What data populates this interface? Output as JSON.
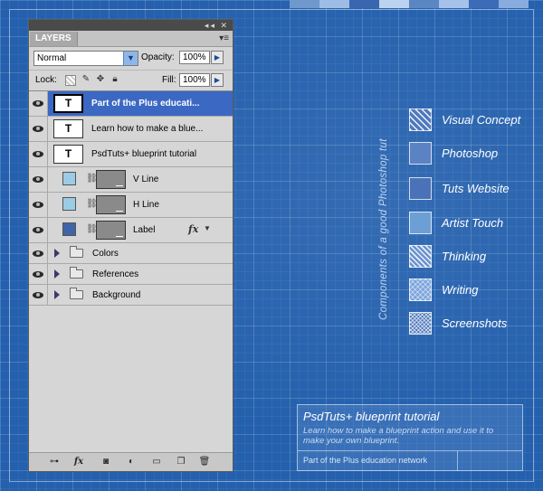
{
  "canvas": {
    "swatch_strip_colors": [
      "#6f98cc",
      "#9dbde6",
      "#3a66b0",
      "#bcd3f0",
      "#5b86c4",
      "#a4c2ea",
      "#3c6cb8",
      "#88acdf"
    ]
  },
  "vertical_caption": "Components of a good Photoshop tut",
  "legend": {
    "items": [
      {
        "label": "Visual Concept",
        "pattern": "stripes-diagonal"
      },
      {
        "label": "Photoshop",
        "pattern": "solid-medium"
      },
      {
        "label": "Tuts Website",
        "pattern": "solid-dark"
      },
      {
        "label": "Artist Touch",
        "pattern": "solid-light"
      },
      {
        "label": "Thinking",
        "pattern": "stripes-diagonal-light"
      },
      {
        "label": "Writing",
        "pattern": "crosshatch-light"
      },
      {
        "label": "Screenshots",
        "pattern": "crosshatch-dense"
      }
    ]
  },
  "info_box": {
    "title": "PsdTuts+ blueprint tutorial",
    "description": "Learn how to make a blueprint action and use it to make your own blueprint.",
    "footer": "Part of the Plus education network"
  },
  "layers_panel": {
    "titlebar_icons": "◂◂ ✕",
    "tab": "LAYERS",
    "menu_icon": "▾≡",
    "blend_mode": "Normal",
    "opacity_label": "Opacity:",
    "opacity": "100%",
    "lock_label": "Lock:",
    "fill_label": "Fill:",
    "fill": "100%",
    "layers": [
      {
        "kind": "type",
        "name": "Part of the Plus educati...",
        "thumb": "T",
        "selected": true
      },
      {
        "kind": "type",
        "name": "Learn how to make a blue...",
        "thumb": "T",
        "selected": false
      },
      {
        "kind": "type",
        "name": "PsdTuts+ blueprint tutorial",
        "thumb": "T",
        "selected": false
      },
      {
        "kind": "shape",
        "name": "V Line",
        "swatch": "#9ccbe6",
        "fx": false
      },
      {
        "kind": "shape",
        "name": "H Line",
        "swatch": "#9ccbe6",
        "fx": false
      },
      {
        "kind": "shape",
        "name": "Label",
        "swatch": "#3f64a8",
        "fx": true,
        "fx_label": "fx"
      },
      {
        "kind": "group",
        "name": "Colors"
      },
      {
        "kind": "group",
        "name": "References"
      },
      {
        "kind": "group",
        "name": "Background"
      }
    ],
    "bottom_icons": [
      {
        "name": "link-layers-icon",
        "glyph": "⊶"
      },
      {
        "name": "layer-style-icon",
        "glyph": "fx"
      },
      {
        "name": "add-mask-icon",
        "glyph": "◙"
      },
      {
        "name": "adjustment-layer-icon",
        "glyph": "◐"
      },
      {
        "name": "new-group-icon",
        "glyph": "▭"
      },
      {
        "name": "new-layer-icon",
        "glyph": "❐"
      },
      {
        "name": "delete-layer-icon",
        "glyph": "🗑"
      }
    ]
  }
}
